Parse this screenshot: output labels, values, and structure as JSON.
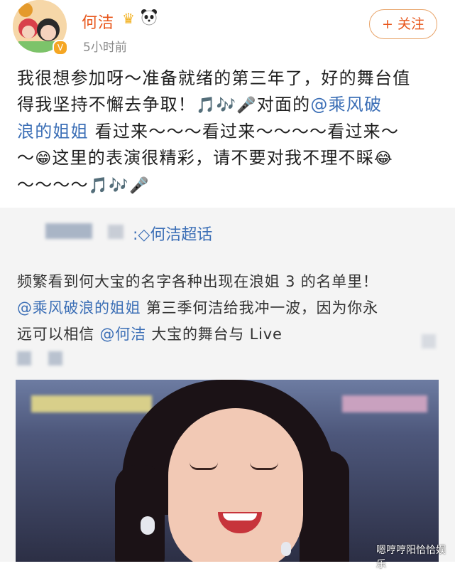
{
  "post": {
    "author": "何洁",
    "time": "5小时前",
    "follow_label": "+ 关注",
    "line1": "我很想参加呀～准备就绪的第三年了，好的舞台值",
    "line2_a": "得我坚持不懈去争取！",
    "line2_mention": "@乘风破",
    "line3_mention": "浪的姐姐",
    "line3_b": " 看过来～～～看过来～～～～看过来～",
    "line4_a": "～",
    "line4_b": "这里的表演很精彩，请不要对我不理不睬",
    "line5_a": "～～～～",
    "line2_mid": "对面的"
  },
  "repost": {
    "topic": "何洁超话",
    "line1": "频繁看到何大宝的名字各种出现在浪姐 3 的名单里！",
    "line2_mention": "@乘风破浪的姐姐",
    "line2_b": " 第三季何洁给我冲一波，因为你永",
    "line3_a": "远可以相信 ",
    "line3_mention": "@何洁",
    "line3_b": " 大宝的舞台与 Live"
  },
  "watermark": "嗯哼哼阳恰恰娱乐",
  "colors": {
    "accent": "#e8571c",
    "link": "#3c6fb6"
  }
}
